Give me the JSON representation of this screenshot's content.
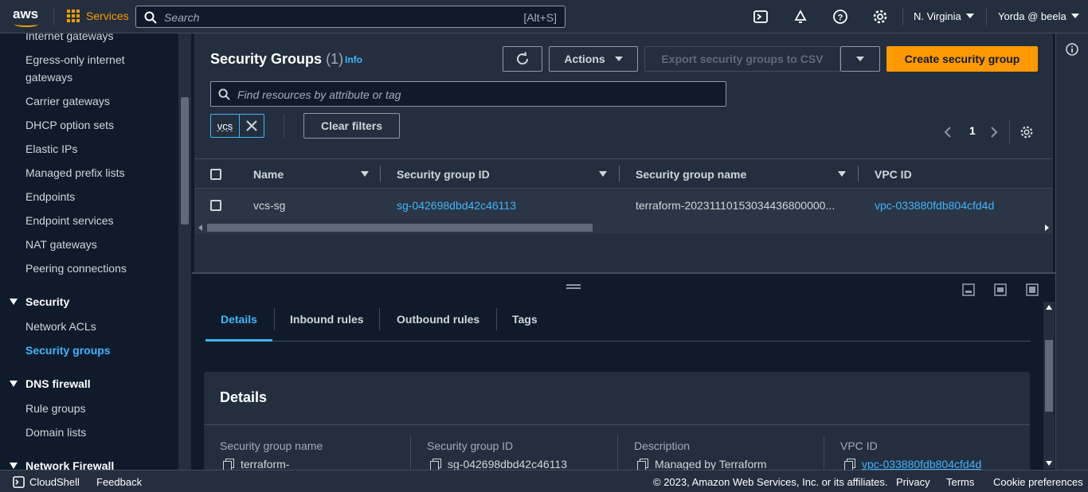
{
  "topbar": {
    "logo": "aws",
    "services_label": "Services",
    "search_placeholder": "Search",
    "search_shortcut": "[Alt+S]",
    "region": "N. Virginia",
    "user": "Yorda @ beela"
  },
  "sidebar": {
    "items": [
      {
        "label": "Internet gateways"
      },
      {
        "label": "Egress-only internet gateways"
      },
      {
        "label": "Carrier gateways"
      },
      {
        "label": "DHCP option sets"
      },
      {
        "label": "Elastic IPs"
      },
      {
        "label": "Managed prefix lists"
      },
      {
        "label": "Endpoints"
      },
      {
        "label": "Endpoint services"
      },
      {
        "label": "NAT gateways"
      },
      {
        "label": "Peering connections"
      }
    ],
    "security_section": "Security",
    "security_items": [
      "Network ACLs",
      "Security groups"
    ],
    "dns_section": "DNS firewall",
    "dns_items": [
      "Rule groups",
      "Domain lists"
    ],
    "nf_section": "Network Firewall"
  },
  "main": {
    "title": "Security Groups",
    "count": "(1)",
    "info": "Info",
    "actions_label": "Actions",
    "export_label": "Export security groups to CSV",
    "create_label": "Create security group",
    "filter_placeholder": "Find resources by attribute or tag",
    "token": "vcs",
    "clear_filters": "Clear filters",
    "page": "1",
    "columns": [
      "Name",
      "Security group ID",
      "Security group name",
      "VPC ID"
    ],
    "rows": [
      {
        "name": "vcs-sg",
        "sg_id": "sg-042698dbd42c46113",
        "sg_name": "terraform-20231110153034436800000...",
        "vpc_id": "vpc-033880fdb804cfd4d"
      }
    ]
  },
  "detail": {
    "tabs": [
      "Details",
      "Inbound rules",
      "Outbound rules",
      "Tags"
    ],
    "heading": "Details",
    "fields": [
      {
        "label": "Security group name",
        "value": "terraform-"
      },
      {
        "label": "Security group ID",
        "value": "sg-042698dbd42c46113"
      },
      {
        "label": "Description",
        "value": "Managed by Terraform"
      },
      {
        "label": "VPC ID",
        "value": "vpc-033880fdb804cfd4d"
      }
    ]
  },
  "footer": {
    "cloudshell": "CloudShell",
    "feedback": "Feedback",
    "copyright": "© 2023, Amazon Web Services, Inc. or its affiliates.",
    "privacy": "Privacy",
    "terms": "Terms",
    "cookies": "Cookie preferences"
  },
  "colors": {
    "accent": "#ff9900",
    "link": "#42b4ff",
    "bg": "#0f1b2a",
    "panel": "#232f3e"
  }
}
